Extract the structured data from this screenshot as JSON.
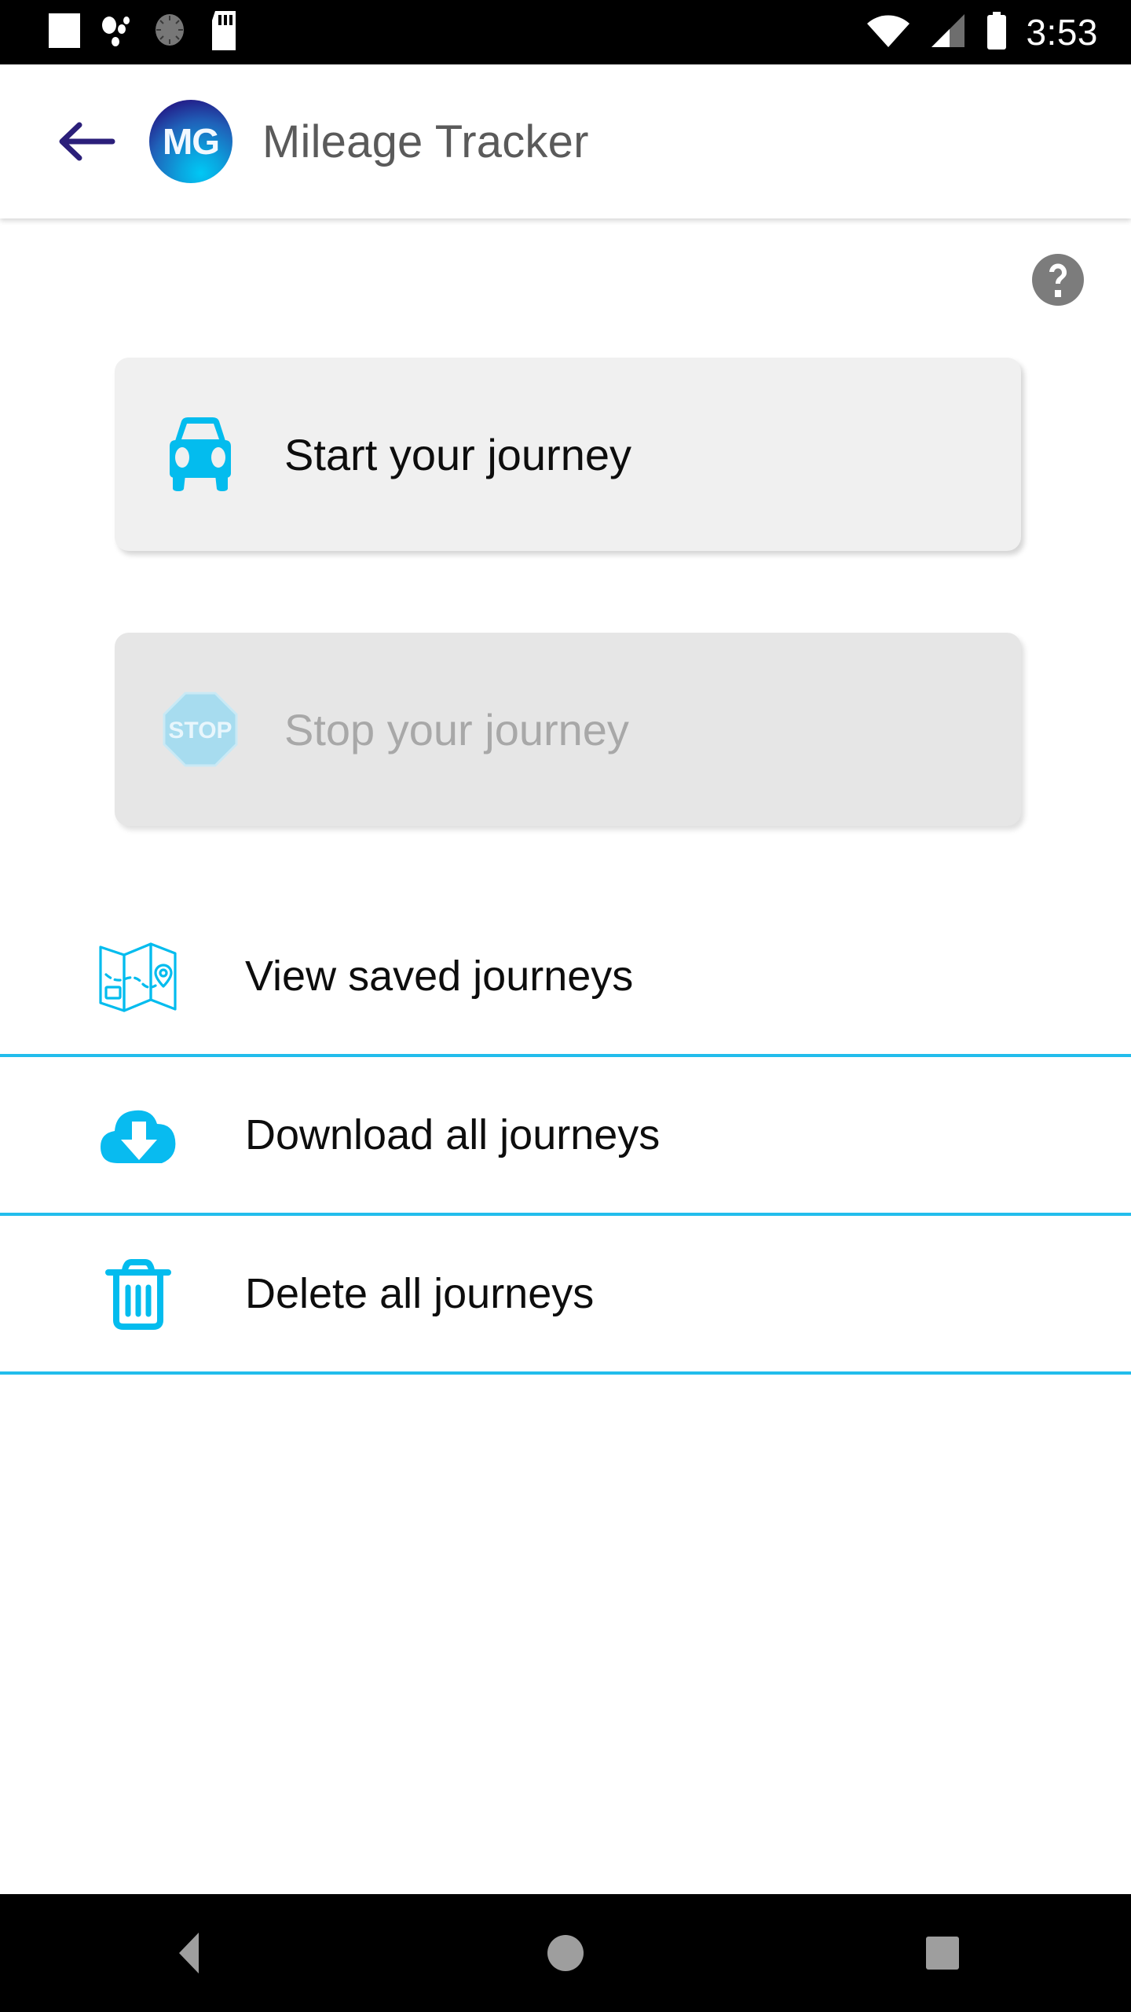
{
  "status_bar": {
    "icons": [
      "blank-notification-icon",
      "dots-icon",
      "alarm-dial-icon",
      "sd-card-icon"
    ],
    "wifi_icon": "wifi-icon",
    "signal_icon": "cellular-signal-icon",
    "battery_icon": "battery-full-icon",
    "time": "3:53"
  },
  "app_bar": {
    "back_icon": "back-arrow-icon",
    "logo_text": "MG",
    "title": "Mileage Tracker"
  },
  "content": {
    "help_icon": "help-question-icon",
    "cards": [
      {
        "label": "Start your journey",
        "icon": "car-front-icon",
        "enabled": true
      },
      {
        "label": "Stop your journey",
        "icon": "stop-sign-icon",
        "stop_sign_text": "STOP",
        "enabled": false
      }
    ],
    "list_items": [
      {
        "label": "View saved journeys",
        "icon": "folded-map-icon"
      },
      {
        "label": "Download all journeys",
        "icon": "cloud-download-icon"
      },
      {
        "label": "Delete all journeys",
        "icon": "trash-can-icon"
      }
    ]
  },
  "nav_bar": {
    "back_label": "back-triangle-icon",
    "home_label": "home-circle-icon",
    "recents_label": "recents-square-icon"
  },
  "colors": {
    "accent_cyan": "#22bdec",
    "icon_cyan": "#03bcee",
    "card_enabled_bg": "#f0f0f0",
    "card_disabled_bg": "#e6e6e6",
    "disabled_text": "#a8a8a8",
    "title_gray": "#5a5a5a",
    "help_gray": "#7c7c7c",
    "logo_navy": "#22207e",
    "back_arrow_navy": "#2b1f7a"
  }
}
